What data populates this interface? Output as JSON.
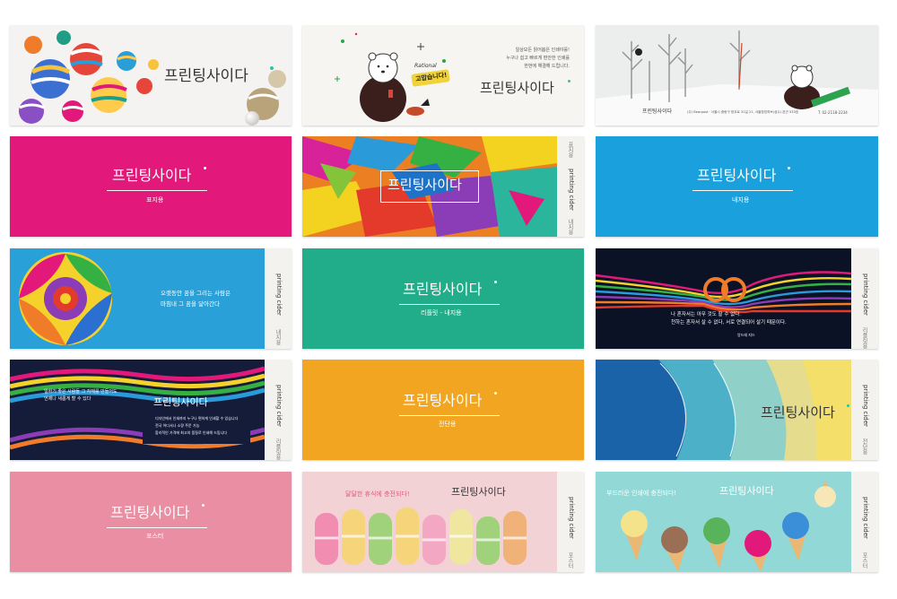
{
  "brand": "프린팅사이다",
  "colors": {
    "magenta": "#e2197a",
    "blue": "#1aa0dc",
    "green": "#21ad8a",
    "orange": "#f2a521",
    "pink": "#e98ea3",
    "navy": "#141c3a",
    "paper": "#f3f2ef"
  },
  "cards": {
    "balls": {
      "icon": "striped-balls"
    },
    "bear": {
      "speech": "고맙습니다!",
      "script": "Rational",
      "lines": [
        "일상모든 읽어봅은 인쇄야를!",
        "누구나 쉽고 빠르게 편안한 인쇄를",
        "한번에 해결해 드립니다."
      ],
      "icon": "bear-character"
    },
    "winter": {
      "footer_brand": "프린팅사이다",
      "footer_info": "(주) Bearpost · 서울시 중랑구 망우로 31길 21, 서울창업허브(성수) 본관 533호",
      "footer_tel": "T. 02-2118-2234"
    },
    "magenta": {
      "label": "표지용"
    },
    "feathers": {
      "spine_top": "표지용",
      "spine_mid": "printing cider",
      "spine_bot": "내지용"
    },
    "blue": {
      "label": "내지용"
    },
    "rose": {
      "quote": [
        "오랫동안 꿈을 그리는 사람은",
        "마침내 그 꿈을 닮아간다"
      ],
      "spine_mid": "printing cider",
      "spine_bot": "내지용"
    },
    "green": {
      "label": "리플릿 - 내지용"
    },
    "knot": {
      "quote": [
        "나 혼자서는 아무 것도 할 수 없다.",
        "천하는 혼자서 살 수 없다, 서로 연결되어 살기 때문이다."
      ],
      "attribution": "앙드레 지드",
      "spine_mid": "printing cider",
      "spine_bot": "리플릿용"
    },
    "ribbon": {
      "quote": [
        "일하기 좋은 사람들 그 자체를 만들어도",
        "언제나 새롭게 할 수 있다"
      ],
      "bullets": [
        "디자인에서 인쇄까지 누구나 편하게 인쇄할 수 있습니다",
        "전국 어디서나 소량 주문 가능",
        "합리적인 가격에 최고의 품질로 인쇄해 드립니다"
      ],
      "spine_mid": "printing cider",
      "spine_bot": "리플릿용"
    },
    "orange": {
      "label": "전단용"
    },
    "sea": {
      "spine_mid": "printing cider",
      "spine_bot": "전단용"
    },
    "pink": {
      "label": "포스터"
    },
    "macarons": {
      "tagline": "달달한 휴식에 충전되다!",
      "spine_mid": "printing cider",
      "spine_bot": "포스터"
    },
    "icecream": {
      "tagline": "부드러운 인쇄에 충전되다!",
      "spine_mid": "printing cider",
      "spine_bot": "포스터"
    }
  }
}
